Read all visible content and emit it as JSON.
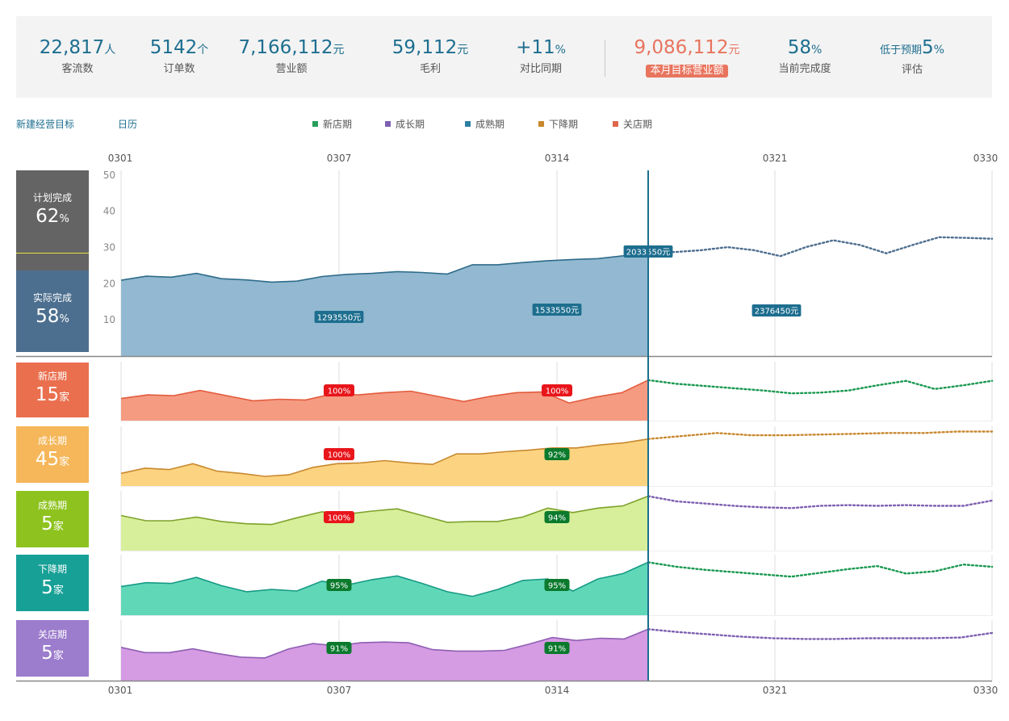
{
  "kpis": [
    {
      "value": "22,817",
      "unit": "人",
      "label": "客流数"
    },
    {
      "value": "5142",
      "unit": "个",
      "label": "订单数"
    },
    {
      "value": "7,166,112",
      "unit": "元",
      "label": "营业额"
    },
    {
      "value": "59,112",
      "unit": "元",
      "label": "毛利"
    },
    {
      "value": "+11",
      "unit": "%",
      "label": "对比同期"
    },
    {
      "value": "9,086,112",
      "unit": "元",
      "label": "本月目标营业额"
    },
    {
      "value": "58",
      "unit": "%",
      "label": "当前完成度"
    },
    {
      "prefix": "低于预期",
      "value": "5",
      "unit": "%",
      "label": "评估"
    }
  ],
  "links": {
    "new_goal": "新建经营目标",
    "calendar": "日历"
  },
  "legend": [
    {
      "label": "新店期",
      "color": "#2a9d5c"
    },
    {
      "label": "成长期",
      "color": "#7d5fb0"
    },
    {
      "label": "成熟期",
      "color": "#2d7fa3"
    },
    {
      "label": "下降期",
      "color": "#c8882f"
    },
    {
      "label": "关店期",
      "color": "#e0664a"
    }
  ],
  "x_ticks": [
    "0301",
    "0307",
    "0314",
    "0321",
    "0330"
  ],
  "summary_panel": {
    "plan": {
      "label": "计划完成",
      "value": "62",
      "unit": "%"
    },
    "actual": {
      "label": "实际完成",
      "value": "58",
      "unit": "%"
    }
  },
  "stage_panels": [
    {
      "label": "新店期",
      "value": "15",
      "unit": "家",
      "color": "#ea6f4e"
    },
    {
      "label": "成长期",
      "value": "45",
      "unit": "家",
      "color": "#f5b75a"
    },
    {
      "label": "成熟期",
      "value": "5",
      "unit": "家",
      "color": "#8ec31f"
    },
    {
      "label": "下降期",
      "value": "5",
      "unit": "家",
      "color": "#17a096"
    },
    {
      "label": "关店期",
      "value": "5",
      "unit": "家",
      "color": "#9c7ccc"
    }
  ],
  "chart_data": [
    {
      "type": "area",
      "x": [
        "0301",
        "0302",
        "0303",
        "0304",
        "0305",
        "0306",
        "0307",
        "0308",
        "0309",
        "0310",
        "0311",
        "0312",
        "0313",
        "0314",
        "0315",
        "0316",
        "0317",
        "0318",
        "0319",
        "0320",
        "0321",
        "0322",
        "0323",
        "0324",
        "0325",
        "0326",
        "0327",
        "0328",
        "0329",
        "0330"
      ],
      "yticks": [
        10,
        20,
        30,
        40,
        50
      ],
      "ylim": [
        0,
        60
      ],
      "actual_values": [
        24.5,
        25.8,
        25.5,
        26.7,
        25.0,
        24.6,
        23.9,
        24.2,
        25.7,
        26.4,
        26.7,
        27.3,
        27.0,
        26.5,
        29.5,
        29.5,
        30.2,
        30.8,
        31.2,
        31.5,
        32.4,
        33.5
      ],
      "forecast_values": [
        33.5,
        33.6,
        34.2,
        35.2,
        34.2,
        32.3,
        35.3,
        37.4,
        35.9,
        33.2,
        35.9,
        38.4,
        38.2,
        37.9
      ],
      "annotations": [
        {
          "x": "0307",
          "label": "1293550元"
        },
        {
          "x": "0314",
          "label": "1533550元"
        },
        {
          "x": "0317",
          "label": "2033550元"
        },
        {
          "x": "0321",
          "label": "2376450元"
        }
      ],
      "fill_color": "#92b9d1",
      "line_color": "#2e6b8a",
      "forecast_color": "#4d6e8f"
    },
    {
      "type": "area",
      "name": "新店期",
      "actual_values": [
        30,
        35,
        34,
        41,
        34,
        27,
        29,
        28,
        36,
        35,
        38,
        40,
        33,
        26,
        33,
        38,
        39,
        24,
        32,
        38,
        55
      ],
      "forecast_values": [
        55,
        50,
        47,
        44,
        41,
        37,
        38,
        41,
        48,
        54,
        43,
        48,
        54
      ],
      "annotations": [
        {
          "x": "0307",
          "label": "100%",
          "color": "red"
        },
        {
          "x": "0314",
          "label": "100%",
          "color": "red"
        }
      ],
      "fill_color": "#f49b82",
      "line_color": "#e35b3c",
      "forecast_color": "#1a9850"
    },
    {
      "type": "area",
      "name": "成长期",
      "actual_values": [
        17,
        24,
        22,
        30,
        20,
        17,
        13,
        15,
        25,
        30,
        31,
        34,
        31,
        29,
        43,
        43,
        46,
        48,
        51,
        51,
        55,
        58,
        63
      ],
      "forecast_values": [
        63,
        67,
        71,
        68,
        68,
        69,
        70,
        71,
        71,
        73,
        73
      ],
      "annotations": [
        {
          "x": "0307",
          "label": "100%",
          "color": "red"
        },
        {
          "x": "0314",
          "label": "92%",
          "color": "green"
        }
      ],
      "fill_color": "#fcd481",
      "line_color": "#c8882f",
      "forecast_color": "#c8882f"
    },
    {
      "type": "area",
      "name": "成熟期",
      "actual_values": [
        47,
        40,
        40,
        45,
        39,
        36,
        35,
        44,
        52,
        49,
        53,
        56,
        47,
        38,
        39,
        39,
        45,
        57,
        51,
        57,
        60,
        73
      ],
      "forecast_values": [
        73,
        66,
        63,
        60,
        58,
        57,
        60,
        61,
        60,
        61,
        60,
        60,
        67
      ],
      "annotations": [
        {
          "x": "0307",
          "label": "100%",
          "color": "red"
        },
        {
          "x": "0314",
          "label": "94%",
          "color": "green"
        }
      ],
      "fill_color": "#d7ef9a",
      "line_color": "#7da22c",
      "forecast_color": "#7d5fb0"
    },
    {
      "type": "area",
      "name": "下降期",
      "actual_values": [
        38,
        43,
        42,
        50,
        39,
        31,
        34,
        32,
        45,
        40,
        47,
        52,
        42,
        31,
        25,
        34,
        46,
        48,
        32,
        48,
        55,
        70
      ],
      "forecast_values": [
        70,
        64,
        60,
        57,
        54,
        51,
        56,
        61,
        65,
        55,
        58,
        67,
        64
      ],
      "annotations": [
        {
          "x": "0307",
          "label": "95%",
          "color": "green"
        },
        {
          "x": "0314",
          "label": "95%",
          "color": "green"
        }
      ],
      "fill_color": "#60d8b8",
      "line_color": "#179a85",
      "forecast_color": "#1a9850"
    },
    {
      "type": "area",
      "name": "关店期",
      "actual_values": [
        44,
        37,
        37,
        42,
        36,
        31,
        30,
        42,
        49,
        46,
        50,
        51,
        50,
        41,
        39,
        39,
        40,
        48,
        57,
        53,
        56,
        55,
        68
      ],
      "forecast_values": [
        68,
        64,
        61,
        58,
        56,
        55,
        55,
        56,
        56,
        56,
        57,
        63
      ],
      "annotations": [
        {
          "x": "0307",
          "label": "91%",
          "color": "green"
        },
        {
          "x": "0314",
          "label": "91%",
          "color": "green"
        }
      ],
      "fill_color": "#d59be3",
      "line_color": "#8e5fb3",
      "forecast_color": "#7d5fb0"
    }
  ]
}
